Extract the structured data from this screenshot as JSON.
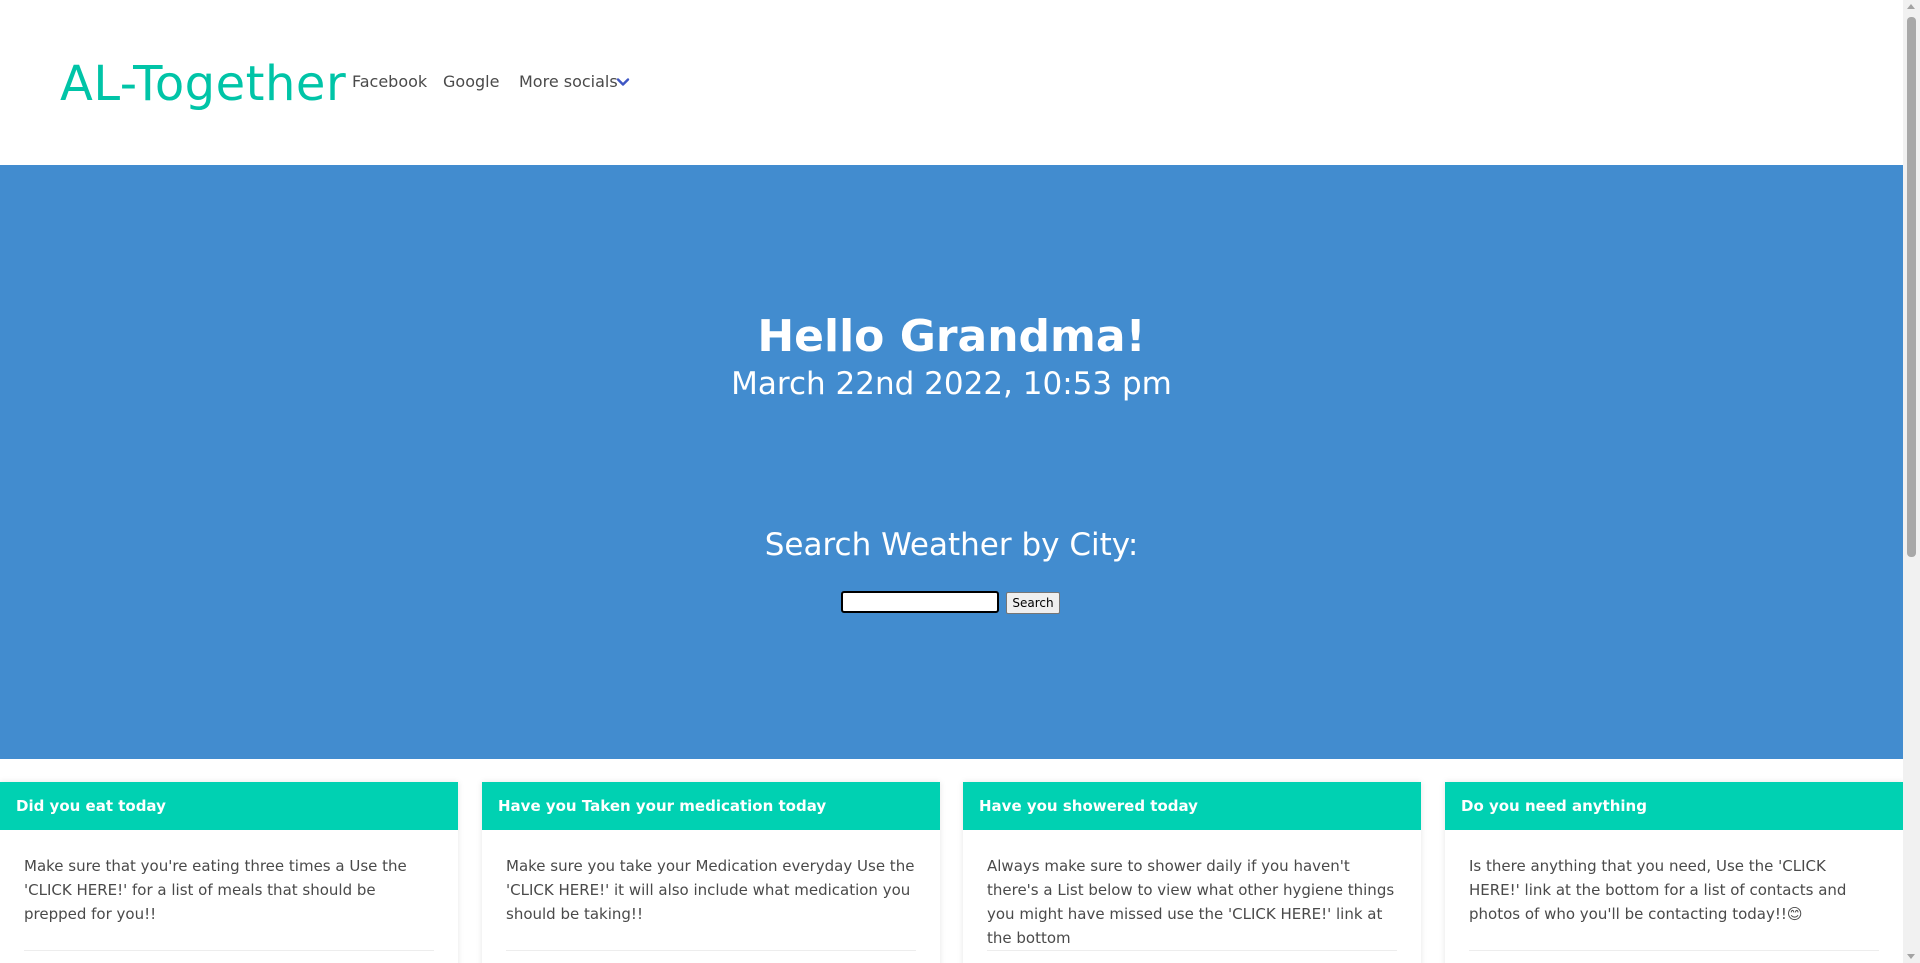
{
  "navbar": {
    "brand": "AL-Together",
    "items": [
      {
        "label": "Facebook"
      },
      {
        "label": "Google"
      },
      {
        "label": "More socials"
      }
    ],
    "more_icon": "chevron-down-icon"
  },
  "hero": {
    "greeting": "Hello Grandma!",
    "datetime": "March 22nd 2022, 10:53 pm",
    "weather_title": "Search Weather by City:",
    "search": {
      "value": "",
      "placeholder": "",
      "button_label": "Search"
    }
  },
  "cards": [
    {
      "title": "Did you eat today",
      "body": "Make sure that you're eating three times a Use the 'CLICK HERE!' for a list of meals that should be prepped for you!!"
    },
    {
      "title": "Have you Taken your medication today",
      "body": "Make sure you take your Medication everyday Use the 'CLICK HERE!' it will also include what medication you should be taking!!"
    },
    {
      "title": "Have you showered today",
      "body": "Always make sure to shower daily if you haven't there's a List below to view what other hygiene things you might have missed use the 'CLICK HERE!' link at the bottom"
    },
    {
      "title": "Do you need anything",
      "body": "Is there anything that you need, Use the 'CLICK HERE!' link at the bottom for a list of contacts and photos of who you'll be contacting today!!😊"
    }
  ],
  "colors": {
    "brand": "#00c4a7",
    "hero_background": "#428ccf",
    "card_header": "#00d1b2",
    "chevron": "#3e56c4"
  }
}
